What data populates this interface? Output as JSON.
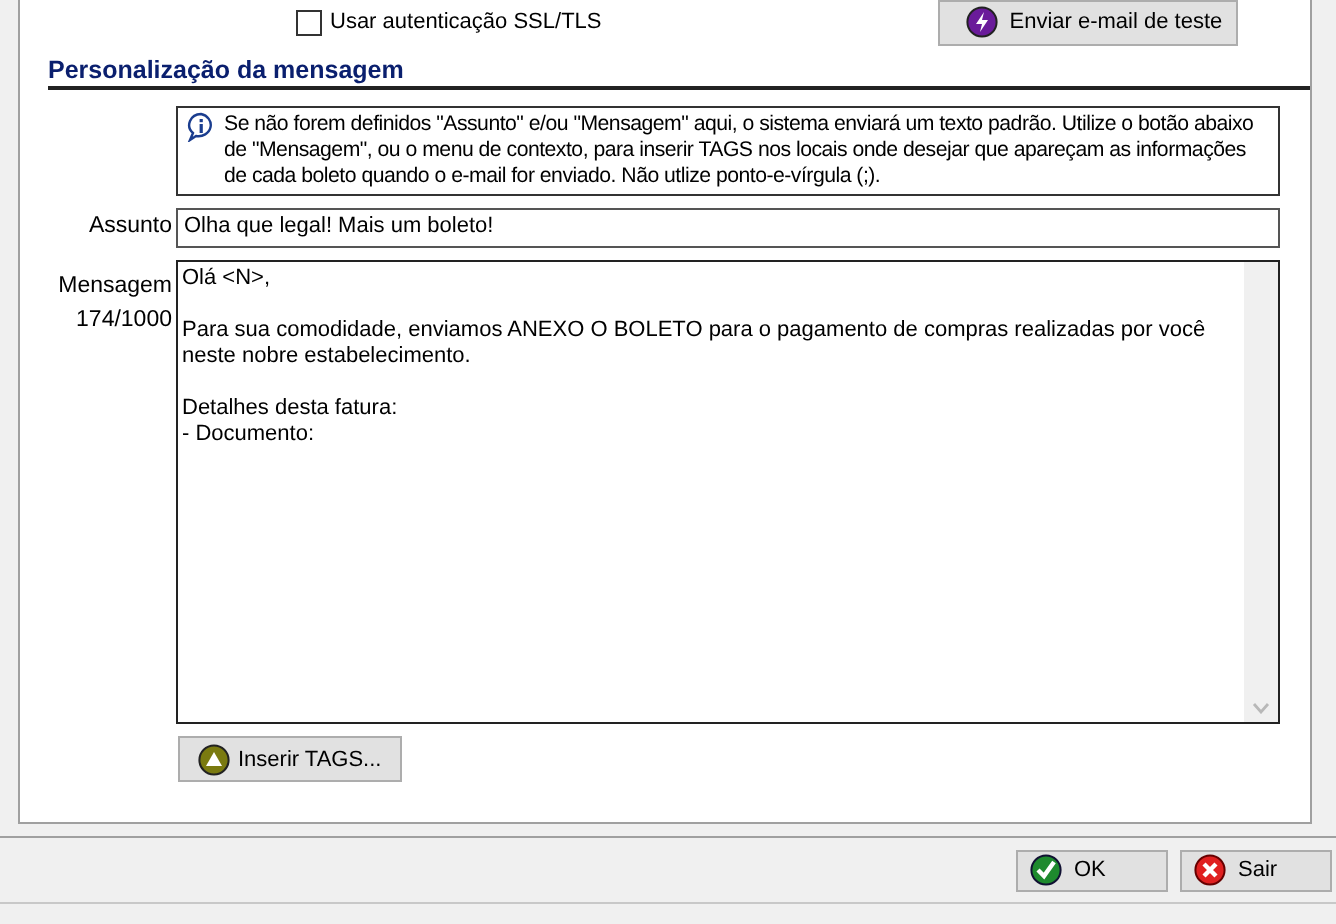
{
  "ssl_option": {
    "label": "Usar autenticação SSL/TLS",
    "checked": false
  },
  "test_button": {
    "label": "Enviar e-mail de teste"
  },
  "section": {
    "title": "Personalização da mensagem"
  },
  "info": {
    "text": "Se não forem definidos \"Assunto\" e/ou \"Mensagem\" aqui, o sistema enviará um texto padrão. Utilize o botão abaixo de \"Mensagem\", ou o menu de contexto, para inserir TAGS nos locais onde desejar que apareçam as informações de cada boleto quando o e-mail for enviado. Não utlize ponto-e-vírgula (;)."
  },
  "subject": {
    "label": "Assunto",
    "value": "Olha que legal! Mais um boleto!"
  },
  "message": {
    "label": "Mensagem",
    "counter": "174/1000",
    "paragraphs": [
      "Olá <N>,",
      "Para sua comodidade, enviamos ANEXO O BOLETO para o pagamento de compras realizadas por você neste nobre estabelecimento.",
      "Detalhes desta fatura:\n- Documento:"
    ]
  },
  "tags_button": {
    "label": "Inserir TAGS..."
  },
  "footer_buttons": [
    {
      "kind": "ok",
      "label": "OK"
    },
    {
      "kind": "cancel",
      "label": "Sair"
    }
  ]
}
